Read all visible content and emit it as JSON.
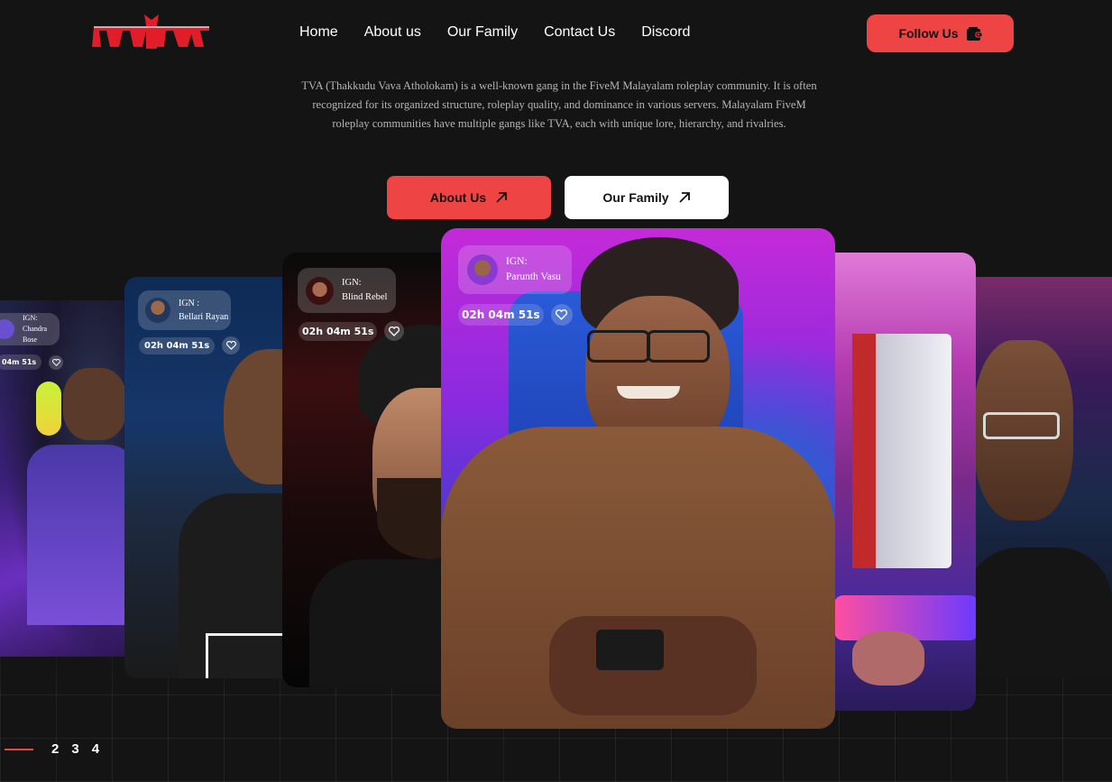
{
  "logo": {
    "text": "TVA",
    "color": "#e11d2a"
  },
  "nav": {
    "items": [
      "Home",
      "About us",
      "Our Family",
      "Contact Us",
      "Discord"
    ]
  },
  "header": {
    "follow_label": "Follow Us",
    "follow_icon": "wallet-icon"
  },
  "intro": {
    "text": "TVA (Thakkudu Vava Atholokam) is a well-known gang in the FiveM Malayalam roleplay community. It is often recognized for its organized structure, roleplay quality, and dominance in various servers. Malayalam FiveM roleplay communities have multiple gangs like TVA, each with unique lore, hierarchy, and rivalries."
  },
  "cta": {
    "about_label": "About Us",
    "family_label": "Our Family",
    "arrow_icon": "arrow-up-right-icon"
  },
  "cards": [
    {
      "ign_label": "IGN:",
      "name": "Chandra Bose",
      "timer": "04m 51s",
      "heart_icon": "heart-icon"
    },
    {
      "ign_label": "IGN :",
      "name": "Bellari Rayan",
      "timer": "02h 04m 51s",
      "heart_icon": "heart-icon"
    },
    {
      "ign_label": "IGN:",
      "name": "Blind Rebel",
      "timer": "02h 04m 51s",
      "heart_icon": "heart-icon"
    },
    {
      "ign_label": "IGN:",
      "name": "Parunth Vasu",
      "timer": "02h 04m 51s",
      "heart_icon": "heart-icon"
    }
  ],
  "pager": {
    "pages": [
      "2",
      "3",
      "4"
    ]
  },
  "colors": {
    "accent": "#ef4444",
    "background": "#141414"
  }
}
